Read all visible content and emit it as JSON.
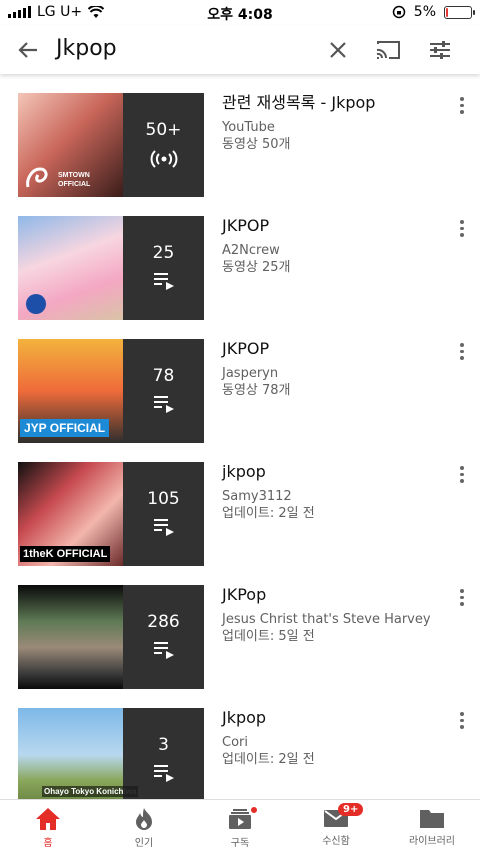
{
  "status_bar": {
    "carrier": "LG U+",
    "time": "오후 4:08",
    "battery_percent": "5%",
    "battery_level": 0.05
  },
  "search": {
    "query": "Jkpop"
  },
  "results": [
    {
      "title": "관련 재생목록 - Jkpop",
      "channel": "YouTube",
      "meta": "동영상 50개",
      "count": "50+",
      "badge": "SMTOWN OFFICIAL",
      "overlay_icon": "live-radio-icon"
    },
    {
      "title": "JKPOP",
      "channel": "A2Ncrew",
      "meta": "동영상 25개",
      "count": "25",
      "badge": "",
      "overlay_icon": "playlist-icon"
    },
    {
      "title": "JKPOP",
      "channel": "Jasperyn",
      "meta": "동영상 78개",
      "count": "78",
      "badge": "JYP OFFICIAL",
      "overlay_icon": "playlist-icon"
    },
    {
      "title": "jkpop",
      "channel": "Samy3112",
      "meta": "업데이트: 2일 전",
      "count": "105",
      "badge": "1theK OFFICIAL",
      "overlay_icon": "playlist-icon"
    },
    {
      "title": "JKPop",
      "channel": "Jesus Christ that's Steve Harvey",
      "meta": "업데이트: 5일 전",
      "count": "286",
      "badge": "",
      "overlay_icon": "playlist-icon"
    },
    {
      "title": "Jkpop",
      "channel": "Cori",
      "meta": "업데이트: 2일 전",
      "count": "3",
      "badge": "Ohayo Tokyo Konichiwa",
      "overlay_icon": "playlist-icon"
    }
  ],
  "bottom_nav": [
    {
      "label": "홈",
      "icon": "home-icon",
      "active": true
    },
    {
      "label": "인기",
      "icon": "flame-icon",
      "active": false
    },
    {
      "label": "구독",
      "icon": "subscriptions-icon",
      "active": false
    },
    {
      "label": "수신함",
      "icon": "inbox-icon",
      "active": false,
      "badge": "9+"
    },
    {
      "label": "라이브러리",
      "icon": "folder-icon",
      "active": false
    }
  ],
  "colors": {
    "accent_red": "#e52d27",
    "text_secondary": "#606060"
  }
}
